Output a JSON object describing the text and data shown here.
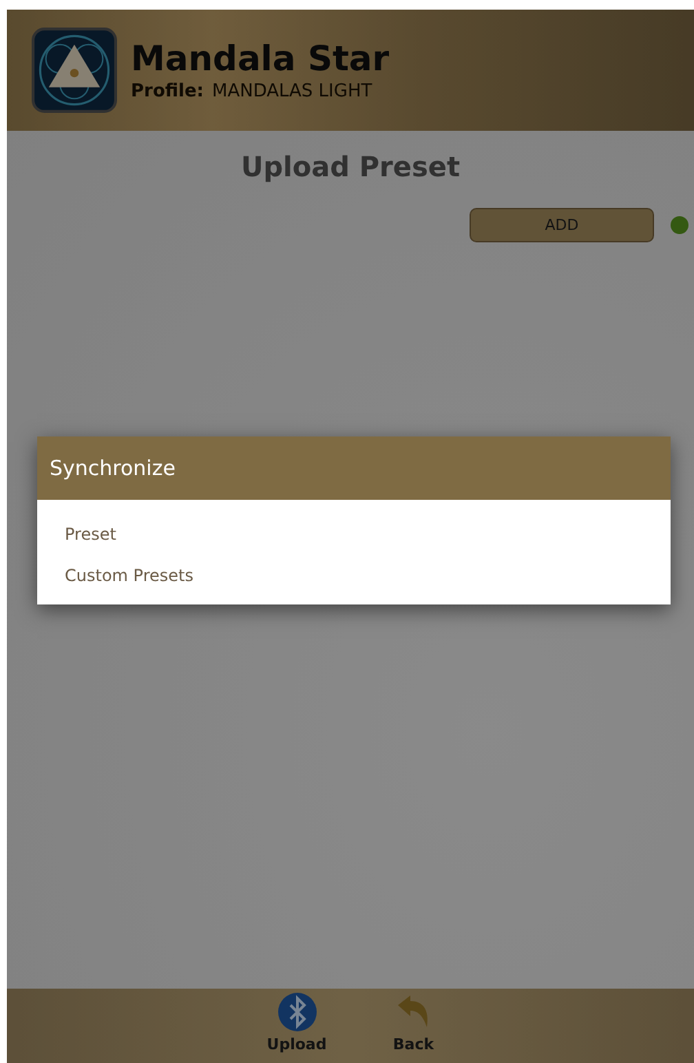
{
  "header": {
    "title": "Mandala Star",
    "profile_label": "Profile:",
    "profile_name": "MANDALAS LIGHT"
  },
  "page": {
    "title": "Upload Preset",
    "add_button": "ADD",
    "connected": true
  },
  "dialog": {
    "title": "Synchronize",
    "items": [
      {
        "label": "Preset"
      },
      {
        "label": "Custom Presets"
      }
    ]
  },
  "bottom_bar": [
    {
      "kind": "bluetooth",
      "label": "Upload"
    },
    {
      "kind": "back",
      "label": "Back"
    }
  ]
}
